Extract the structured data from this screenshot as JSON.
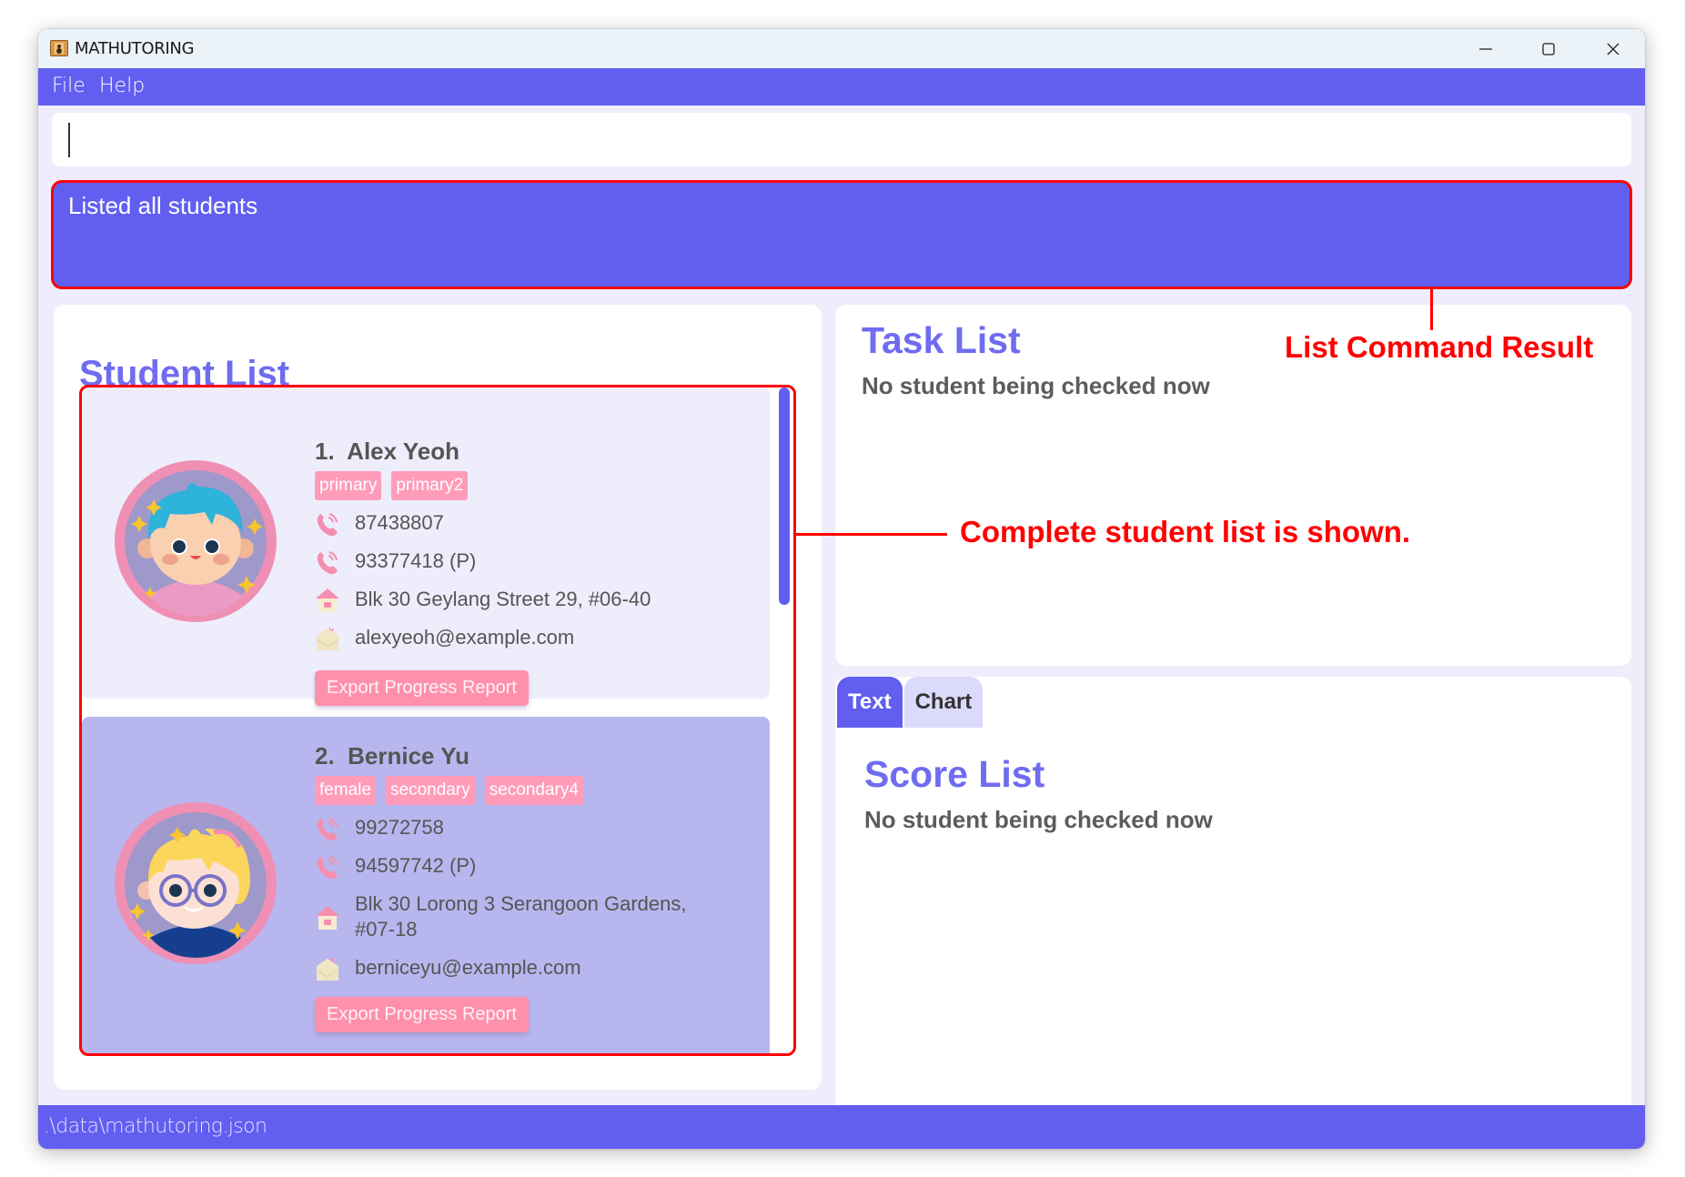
{
  "window": {
    "title": "MATHUTORING",
    "controls": {
      "minimize": "minimize",
      "maximize": "maximize",
      "close": "close"
    }
  },
  "menu": {
    "items": [
      "File",
      "Help"
    ]
  },
  "command": {
    "value": "",
    "placeholder": ""
  },
  "result": {
    "text": "Listed all students"
  },
  "student_list": {
    "title": "Student List",
    "students": [
      {
        "index": "1.",
        "name": "Alex Yeoh",
        "tags": [
          "primary",
          "primary2"
        ],
        "phone": "87438807",
        "parent_phone": "93377418 (P)",
        "address": "Blk 30 Geylang Street 29, #06-40",
        "email": "alexyeoh@example.com",
        "avatar": "boy-blue-hair-avatar",
        "button": "Export Progress Report"
      },
      {
        "index": "2.",
        "name": "Bernice Yu",
        "tags": [
          "female",
          "secondary",
          "secondary4"
        ],
        "phone": "99272758",
        "parent_phone": "94597742 (P)",
        "address": "Blk 30 Lorong 3 Serangoon Gardens, #07-18",
        "email": "berniceyu@example.com",
        "avatar": "girl-glasses-avatar",
        "button": "Export Progress Report"
      }
    ]
  },
  "task_list": {
    "title": "Task List",
    "message": "No student being checked now"
  },
  "score_tabs": [
    {
      "label": "Text",
      "active": true
    },
    {
      "label": "Chart",
      "active": false
    }
  ],
  "score_list": {
    "title": "Score List",
    "message": "No student being checked now"
  },
  "status": {
    "path": ".\\data\\mathutoring.json"
  },
  "annotations": {
    "result": "List Command Result",
    "list": "Complete student list is shown."
  },
  "colors": {
    "primary": "#615ef0",
    "background": "#efedfb",
    "title": "#6f6cf0",
    "tag": "#ff9cba",
    "button": "#ff90ac",
    "annotation": "#ff0000"
  }
}
